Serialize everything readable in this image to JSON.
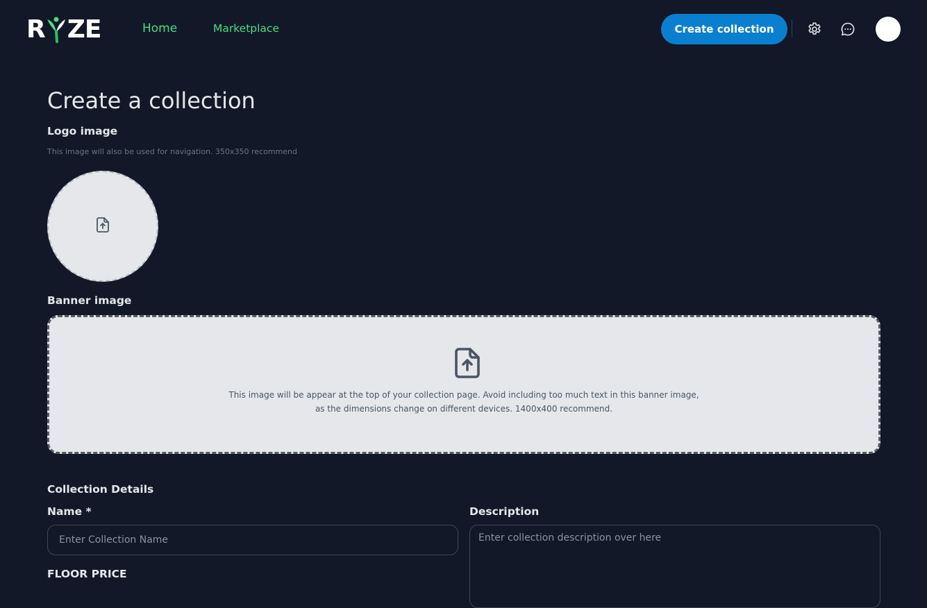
{
  "brand": {
    "logo_text_left": "R",
    "logo_text_right": "ZE"
  },
  "nav": {
    "home": "Home",
    "marketplace": "Marketplace",
    "create_collection": "Create collection"
  },
  "icons": {
    "settings": "gear-icon",
    "messages": "chat-bubble-icon",
    "upload": "file-upload-icon"
  },
  "colors": {
    "background": "#121828",
    "accent_green": "#4ade80",
    "primary_button": "#0b7fcf"
  },
  "page": {
    "title": "Create a collection",
    "logo_image": {
      "label": "Logo image",
      "hint": "This image will also be used for navigation. 350x350 recommend"
    },
    "banner_image": {
      "label": "Banner image",
      "hint_line1": "This image will be appear at the top of your collection page. Avoid including too much text in this banner image,",
      "hint_line2": "as the dimensions change on different devices. 1400x400 recommend."
    },
    "details": {
      "heading": "Collection Details",
      "name_label": "Name *",
      "name_placeholder": "Enter Collection Name",
      "name_value": "",
      "description_label": "Description",
      "description_placeholder": "Enter collection description over here",
      "description_value": "",
      "floor_price_label": "FLOOR PRICE"
    }
  }
}
